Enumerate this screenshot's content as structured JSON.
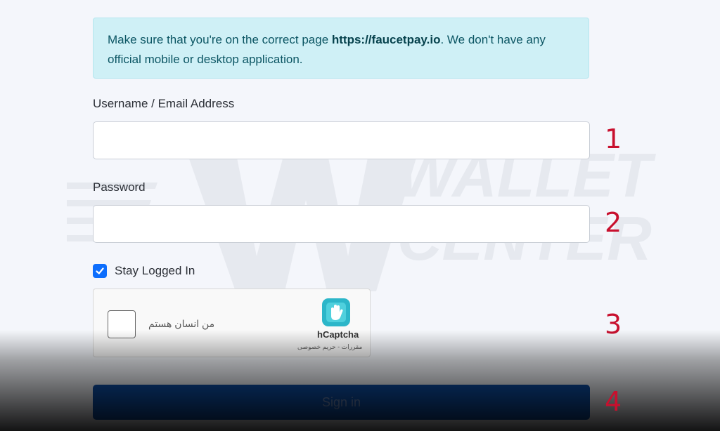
{
  "alert": {
    "text_before": "Make sure that you're on the correct page ",
    "url": "https://faucetpay.io",
    "text_after": ". We don't have any official mobile or desktop application."
  },
  "form": {
    "username_label": "Username / Email Address",
    "username_value": "",
    "password_label": "Password",
    "password_value": "",
    "stay_logged_in_label": "Stay Logged In",
    "stay_logged_in_checked": true,
    "signin_label": "Sign in"
  },
  "captcha": {
    "checkbox_text": "من انسان هستم",
    "brand": "hCaptcha",
    "links": "مقررات - حریم خصوصی"
  },
  "markers": [
    "1",
    "2",
    "3",
    "4"
  ],
  "watermark": {
    "line1": "WALLET",
    "line2": "CENTER"
  },
  "colors": {
    "accent": "#0d6efd",
    "button": "#0d4fa8",
    "marker": "#c8102e",
    "alert_bg": "#cff0f6"
  }
}
